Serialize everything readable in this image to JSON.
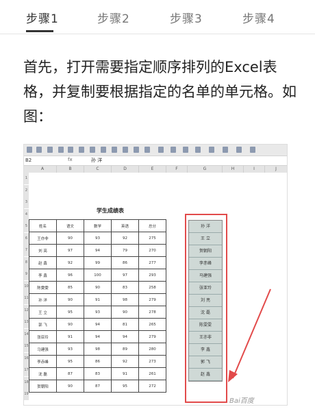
{
  "tabs": [
    "步骤1",
    "步骤2",
    "步骤3",
    "步骤4"
  ],
  "intro_text": "首先，打开需要指定顺序排列的Excel表格，并复制要根据指定的名单的单元格。如图：",
  "spreadsheet": {
    "name_box": "B2",
    "fx_label": "fx",
    "formula_value": "孙 洋",
    "column_letters": [
      "A",
      "B",
      "C",
      "D",
      "E",
      "F",
      "G",
      "H",
      "I",
      "J"
    ],
    "row_numbers": [
      "1",
      "2",
      "3",
      "4",
      "5",
      "6",
      "7",
      "8",
      "9",
      "10",
      "11",
      "12",
      "13",
      "14",
      "15",
      "16",
      "17",
      "18",
      "19"
    ],
    "table_title": "学生成绩表",
    "headers": [
      "姓名",
      "语文",
      "数学",
      "英语",
      "总分"
    ],
    "rows": [
      [
        "王亦非",
        "90",
        "93",
        "92",
        "275"
      ],
      [
        "刘 亮",
        "97",
        "94",
        "79",
        "270"
      ],
      [
        "赵 鑫",
        "92",
        "99",
        "86",
        "277"
      ],
      [
        "李 鑫",
        "96",
        "100",
        "97",
        "293"
      ],
      [
        "陈雯雯",
        "85",
        "90",
        "83",
        "258"
      ],
      [
        "孙 洋",
        "90",
        "91",
        "98",
        "279"
      ],
      [
        "王 立",
        "95",
        "93",
        "90",
        "278"
      ],
      [
        "郭 飞",
        "90",
        "94",
        "81",
        "265"
      ],
      [
        "张亚玲",
        "91",
        "94",
        "94",
        "279"
      ],
      [
        "马建强",
        "93",
        "98",
        "89",
        "280"
      ],
      [
        "李赤峰",
        "95",
        "86",
        "92",
        "273"
      ],
      [
        "沈 磊",
        "87",
        "83",
        "91",
        "261"
      ],
      [
        "贺朝阳",
        "90",
        "87",
        "95",
        "272"
      ]
    ],
    "selected_names": [
      "孙 洋",
      "王 立",
      "贺朝阳",
      "李赤峰",
      "马建强",
      "张亚玲",
      "刘 亮",
      "沈 磊",
      "陈雯雯",
      "王亦非",
      "李 鑫",
      "郭 飞",
      "赵 鑫"
    ]
  },
  "watermark": "Bai百度"
}
